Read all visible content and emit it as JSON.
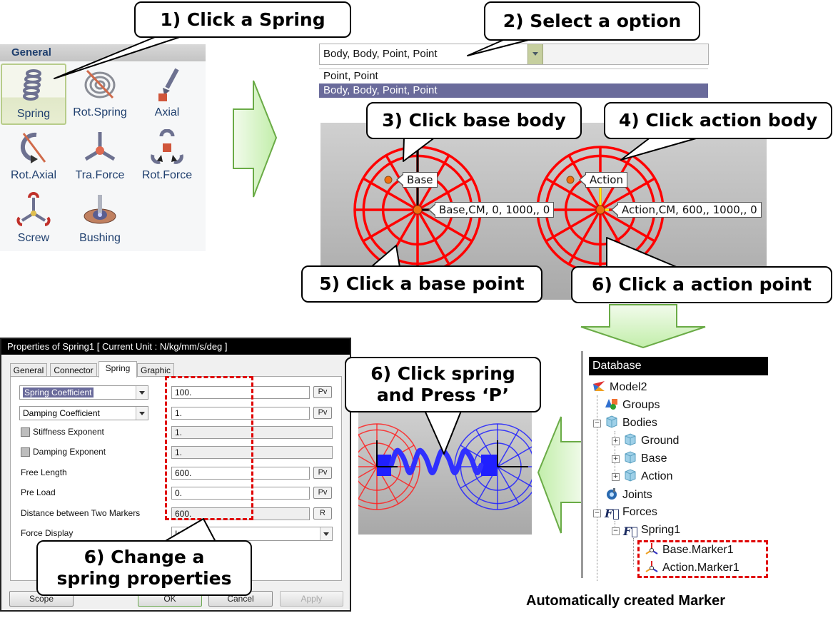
{
  "callouts": {
    "step1": "1) Click a Spring",
    "step2": "2) Select a option",
    "step3": "3) Click base body",
    "step4": "4) Click action body",
    "step5": "5) Click a base point",
    "step6a": "6) Click a action point",
    "step6b_line1": "6) Click spring",
    "step6b_line2": "and Press ‘P’",
    "step6c_line1": "6) Change a",
    "step6c_line2": "spring properties"
  },
  "palette": {
    "header": "General",
    "items": [
      {
        "label": "Spring",
        "icon": "spring-icon",
        "selected": true
      },
      {
        "label": "Rot.Spring",
        "icon": "rot-spring-icon"
      },
      {
        "label": "Axial",
        "icon": "axial-icon"
      },
      {
        "label": "Rot.Axial",
        "icon": "rot-axial-icon"
      },
      {
        "label": "Tra.Force",
        "icon": "tra-force-icon"
      },
      {
        "label": "Rot.Force",
        "icon": "rot-force-icon"
      },
      {
        "label": "Screw",
        "icon": "screw-icon"
      },
      {
        "label": "Bushing",
        "icon": "bushing-icon"
      }
    ]
  },
  "creation_option": {
    "selected": "Body, Body, Point, Point",
    "options": [
      "Point, Point",
      "Body, Body, Point, Point"
    ]
  },
  "viewport": {
    "base_label": "Base",
    "base_cm_label": "Base,CM, 0, 1000,, 0",
    "action_label": "Action",
    "action_cm_label": "Action,CM, 600,, 1000,, 0",
    "base_color": "#ff0000",
    "action_color": "#ff0000"
  },
  "dialog": {
    "title": "Properties of Spring1 [ Current Unit : N/kg/mm/s/deg ]",
    "tabs": [
      "General",
      "Connector",
      "Spring",
      "Graphic"
    ],
    "active_tab": "Spring",
    "fields": {
      "spring_coefficient": {
        "label": "Spring Coefficient",
        "value": "100.",
        "button": "Pv"
      },
      "damping_coefficient": {
        "label": "Damping Coefficient",
        "value": "1.",
        "button": "Pv"
      },
      "stiffness_exponent": {
        "label": "Stiffness Exponent",
        "value": "1.",
        "checked": false
      },
      "damping_exponent": {
        "label": "Damping Exponent",
        "value": "1.",
        "checked": false
      },
      "free_length": {
        "label": "Free Length",
        "value": "600.",
        "button": "Pv"
      },
      "pre_load": {
        "label": "Pre Load",
        "value": "0.",
        "button": "Pv"
      },
      "distance": {
        "label": "Distance between Two Markers",
        "value": "600.",
        "button": "R"
      },
      "force_display": {
        "label": "Force Display",
        "value": "In"
      }
    },
    "buttons": {
      "scope": "Scope",
      "ok": "OK",
      "cancel": "Cancel",
      "apply": "Apply"
    }
  },
  "database": {
    "title": "Database",
    "tree": [
      {
        "label": "Model2",
        "icon": "model-icon"
      },
      {
        "label": "Groups",
        "icon": "groups-icon"
      },
      {
        "label": "Bodies",
        "icon": "body-icon"
      },
      {
        "label": "Ground",
        "icon": "body-icon"
      },
      {
        "label": "Base",
        "icon": "body-icon"
      },
      {
        "label": "Action",
        "icon": "body-icon"
      },
      {
        "label": "Joints",
        "icon": "joints-icon"
      },
      {
        "label": "Forces",
        "icon": "force-icon"
      },
      {
        "label": "Spring1",
        "icon": "force-icon"
      },
      {
        "label": "Base.Marker1",
        "icon": "marker-icon"
      },
      {
        "label": "Action.Marker1",
        "icon": "marker-icon"
      }
    ]
  },
  "footer_caption": "Automatically  created Marker",
  "colors": {
    "highlight": "#e00000",
    "arrow_fill": "#c8f0b0",
    "arrow_stroke": "#6aab46",
    "selection": "#6a6b9b"
  }
}
